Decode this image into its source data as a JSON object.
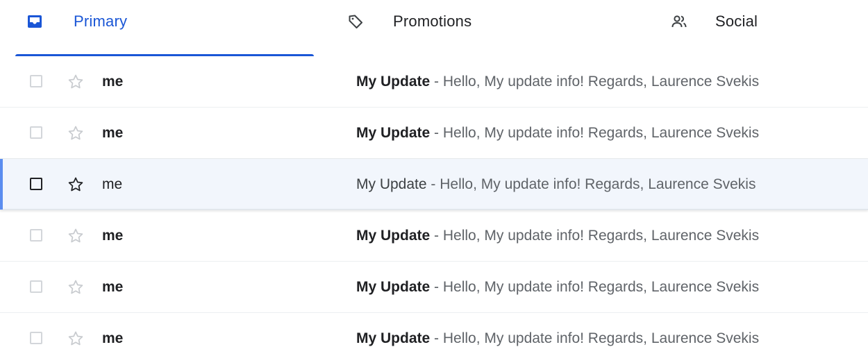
{
  "tabs": [
    {
      "label": "Primary",
      "icon": "inbox-icon",
      "selected": true
    },
    {
      "label": "Promotions",
      "icon": "tag-icon",
      "selected": false
    },
    {
      "label": "Social",
      "icon": "people-icon",
      "selected": false
    }
  ],
  "colors": {
    "accent": "#1a56d6",
    "active_row_bg": "#f2f6fc",
    "active_row_bar": "#5b8def"
  },
  "emails": [
    {
      "sender": "me",
      "subject": "My Update",
      "separator": " - ",
      "snippet": "Hello, My update info! Regards, Laurence Svekis",
      "unread": true
    },
    {
      "sender": "me",
      "subject": "My Update",
      "separator": " - ",
      "snippet": "Hello, My update info! Regards, Laurence Svekis",
      "unread": true
    },
    {
      "sender": "me",
      "subject": "My Update",
      "separator": " - ",
      "snippet": "Hello, My update info! Regards, Laurence Svekis",
      "unread": false,
      "hovered": true
    },
    {
      "sender": "me",
      "subject": "My Update",
      "separator": " - ",
      "snippet": "Hello, My update info! Regards, Laurence Svekis",
      "unread": true
    },
    {
      "sender": "me",
      "subject": "My Update",
      "separator": " - ",
      "snippet": "Hello, My update info! Regards, Laurence Svekis",
      "unread": true
    },
    {
      "sender": "me",
      "subject": "My Update",
      "separator": " - ",
      "snippet": "Hello, My update info! Regards, Laurence Svekis",
      "unread": true
    }
  ]
}
